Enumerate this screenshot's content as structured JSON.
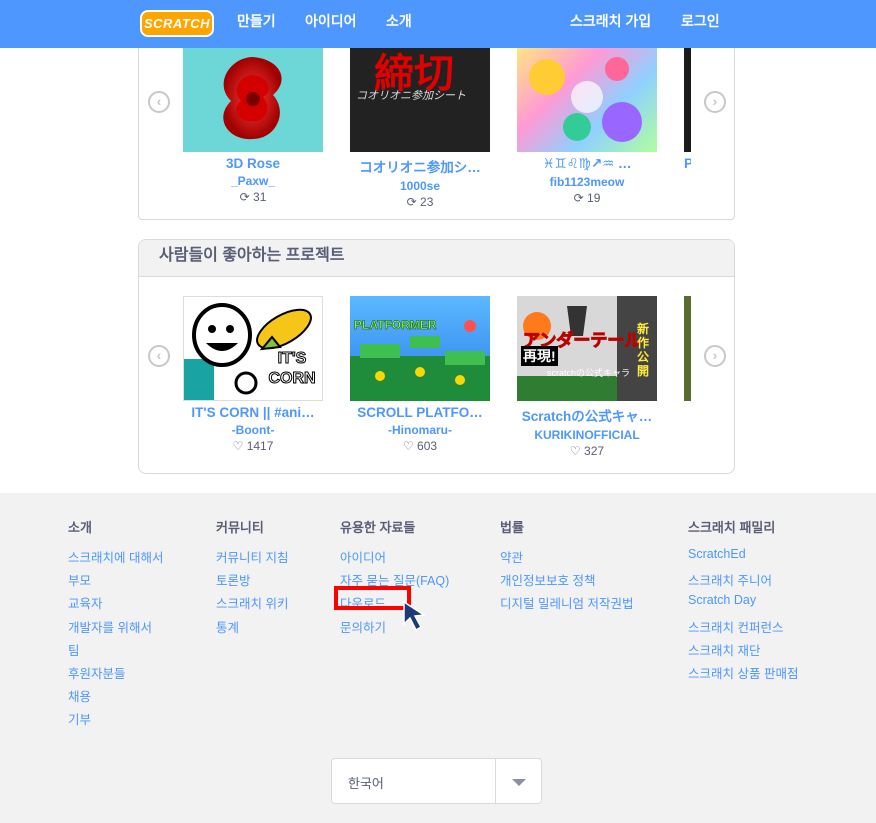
{
  "header": {
    "logo": "SCRATCH",
    "nav": [
      "만들기",
      "아이디어",
      "소개"
    ],
    "join": "스크래치 가입",
    "login": "로그인"
  },
  "row1": {
    "projects": [
      {
        "title": "3D Rose",
        "author": "_Paxw_",
        "count": "31"
      },
      {
        "title": "コオリオニ参加シ…",
        "author": "1000se",
        "count": "23"
      },
      {
        "title": "♓♊♌♍↗♒ …",
        "author": "fib1123meow",
        "count": "19"
      },
      {
        "title": "P"
      }
    ]
  },
  "section2": {
    "heading": "사람들이 좋아하는 프로젝트",
    "projects": [
      {
        "title": "IT'S CORN || #ani…",
        "author": "-Boont-",
        "count": "1417"
      },
      {
        "title": "SCROLL PLATFO…",
        "author": "-Hinomaru-",
        "count": "603"
      },
      {
        "title": "Scratchの公式キャ…",
        "author": "KURIKINOFFICIAL",
        "count": "327"
      }
    ]
  },
  "footer": {
    "columns": [
      {
        "heading": "소개",
        "links": [
          "스크래치에 대해서",
          "부모",
          "교육자",
          "개발자를 위해서",
          "팀",
          "후원자분들",
          "채용",
          "기부"
        ]
      },
      {
        "heading": "커뮤니티",
        "links": [
          "커뮤니티 지침",
          "토론방",
          "스크래치 위키",
          "통계"
        ]
      },
      {
        "heading": "유용한 자료들",
        "links": [
          "아이디어",
          "자주 묻는 질문(FAQ)",
          "다운로드",
          "문의하기"
        ]
      },
      {
        "heading": "법률",
        "links": [
          "약관",
          "개인정보보호 정책",
          "디지털 밀레니엄 저작권법"
        ]
      },
      {
        "heading": "스크래치 패밀리",
        "links": [
          "ScratchEd",
          "스크래치 주니어",
          "Scratch Day",
          "스크래치 컨퍼런스",
          "스크래치 재단",
          "스크래치 상품 판매점"
        ]
      }
    ],
    "language": "한국어"
  },
  "thumb_text": {
    "japanese_title": "締切",
    "japanese_sub": "コオリオニ参加シート",
    "corn": "IT'S CORN",
    "platformer": "PLATFORMER",
    "undertale": "アンダーテール",
    "undertale_sub": "再現!",
    "undertale_official": "scratchの公式キャラ",
    "new_release": "新作公開"
  },
  "colors": {
    "brand": "#4d97ff",
    "footer_bg": "#f2f2f2",
    "highlight": "#ff0000"
  }
}
